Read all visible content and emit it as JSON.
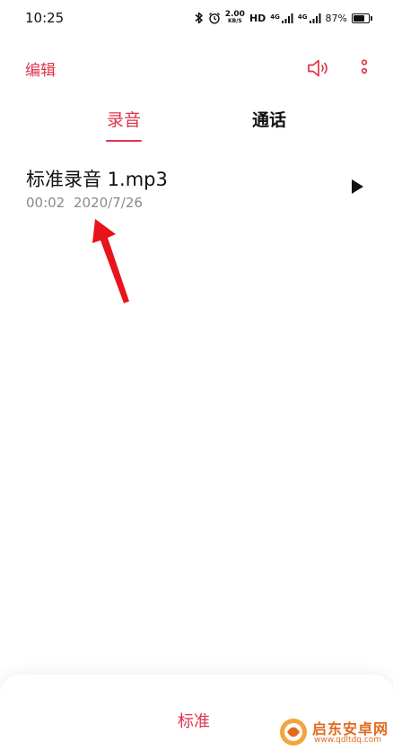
{
  "status_bar": {
    "time": "10:25",
    "speed_value": "2.00",
    "speed_unit": "KB/S",
    "hd_label": "HD",
    "signal1_tag": "4G",
    "signal2_tag": "4G",
    "battery_percent": "87%",
    "battery_level": 0.87
  },
  "toolbar": {
    "edit_label": "编辑"
  },
  "tabs": [
    {
      "label": "录音",
      "selected": true
    },
    {
      "label": "通话",
      "selected": false
    }
  ],
  "recordings": [
    {
      "name": "标准录音 1.mp3",
      "duration": "00:02",
      "date": "2020/7/26"
    }
  ],
  "bottom": {
    "mode_label": "标准"
  },
  "watermark": {
    "title": "启东安卓网",
    "url": "www.qdltdq.com"
  },
  "colors": {
    "accent": "#e0334a",
    "secondary_text": "#8a8a8a",
    "annotation": "#e8141c",
    "watermark": "#e26a1e"
  },
  "icons": {
    "bluetooth": "bluetooth-icon",
    "alarm": "alarm-icon",
    "speaker": "speaker-icon",
    "more": "more-vertical-icon",
    "play": "play-icon"
  }
}
